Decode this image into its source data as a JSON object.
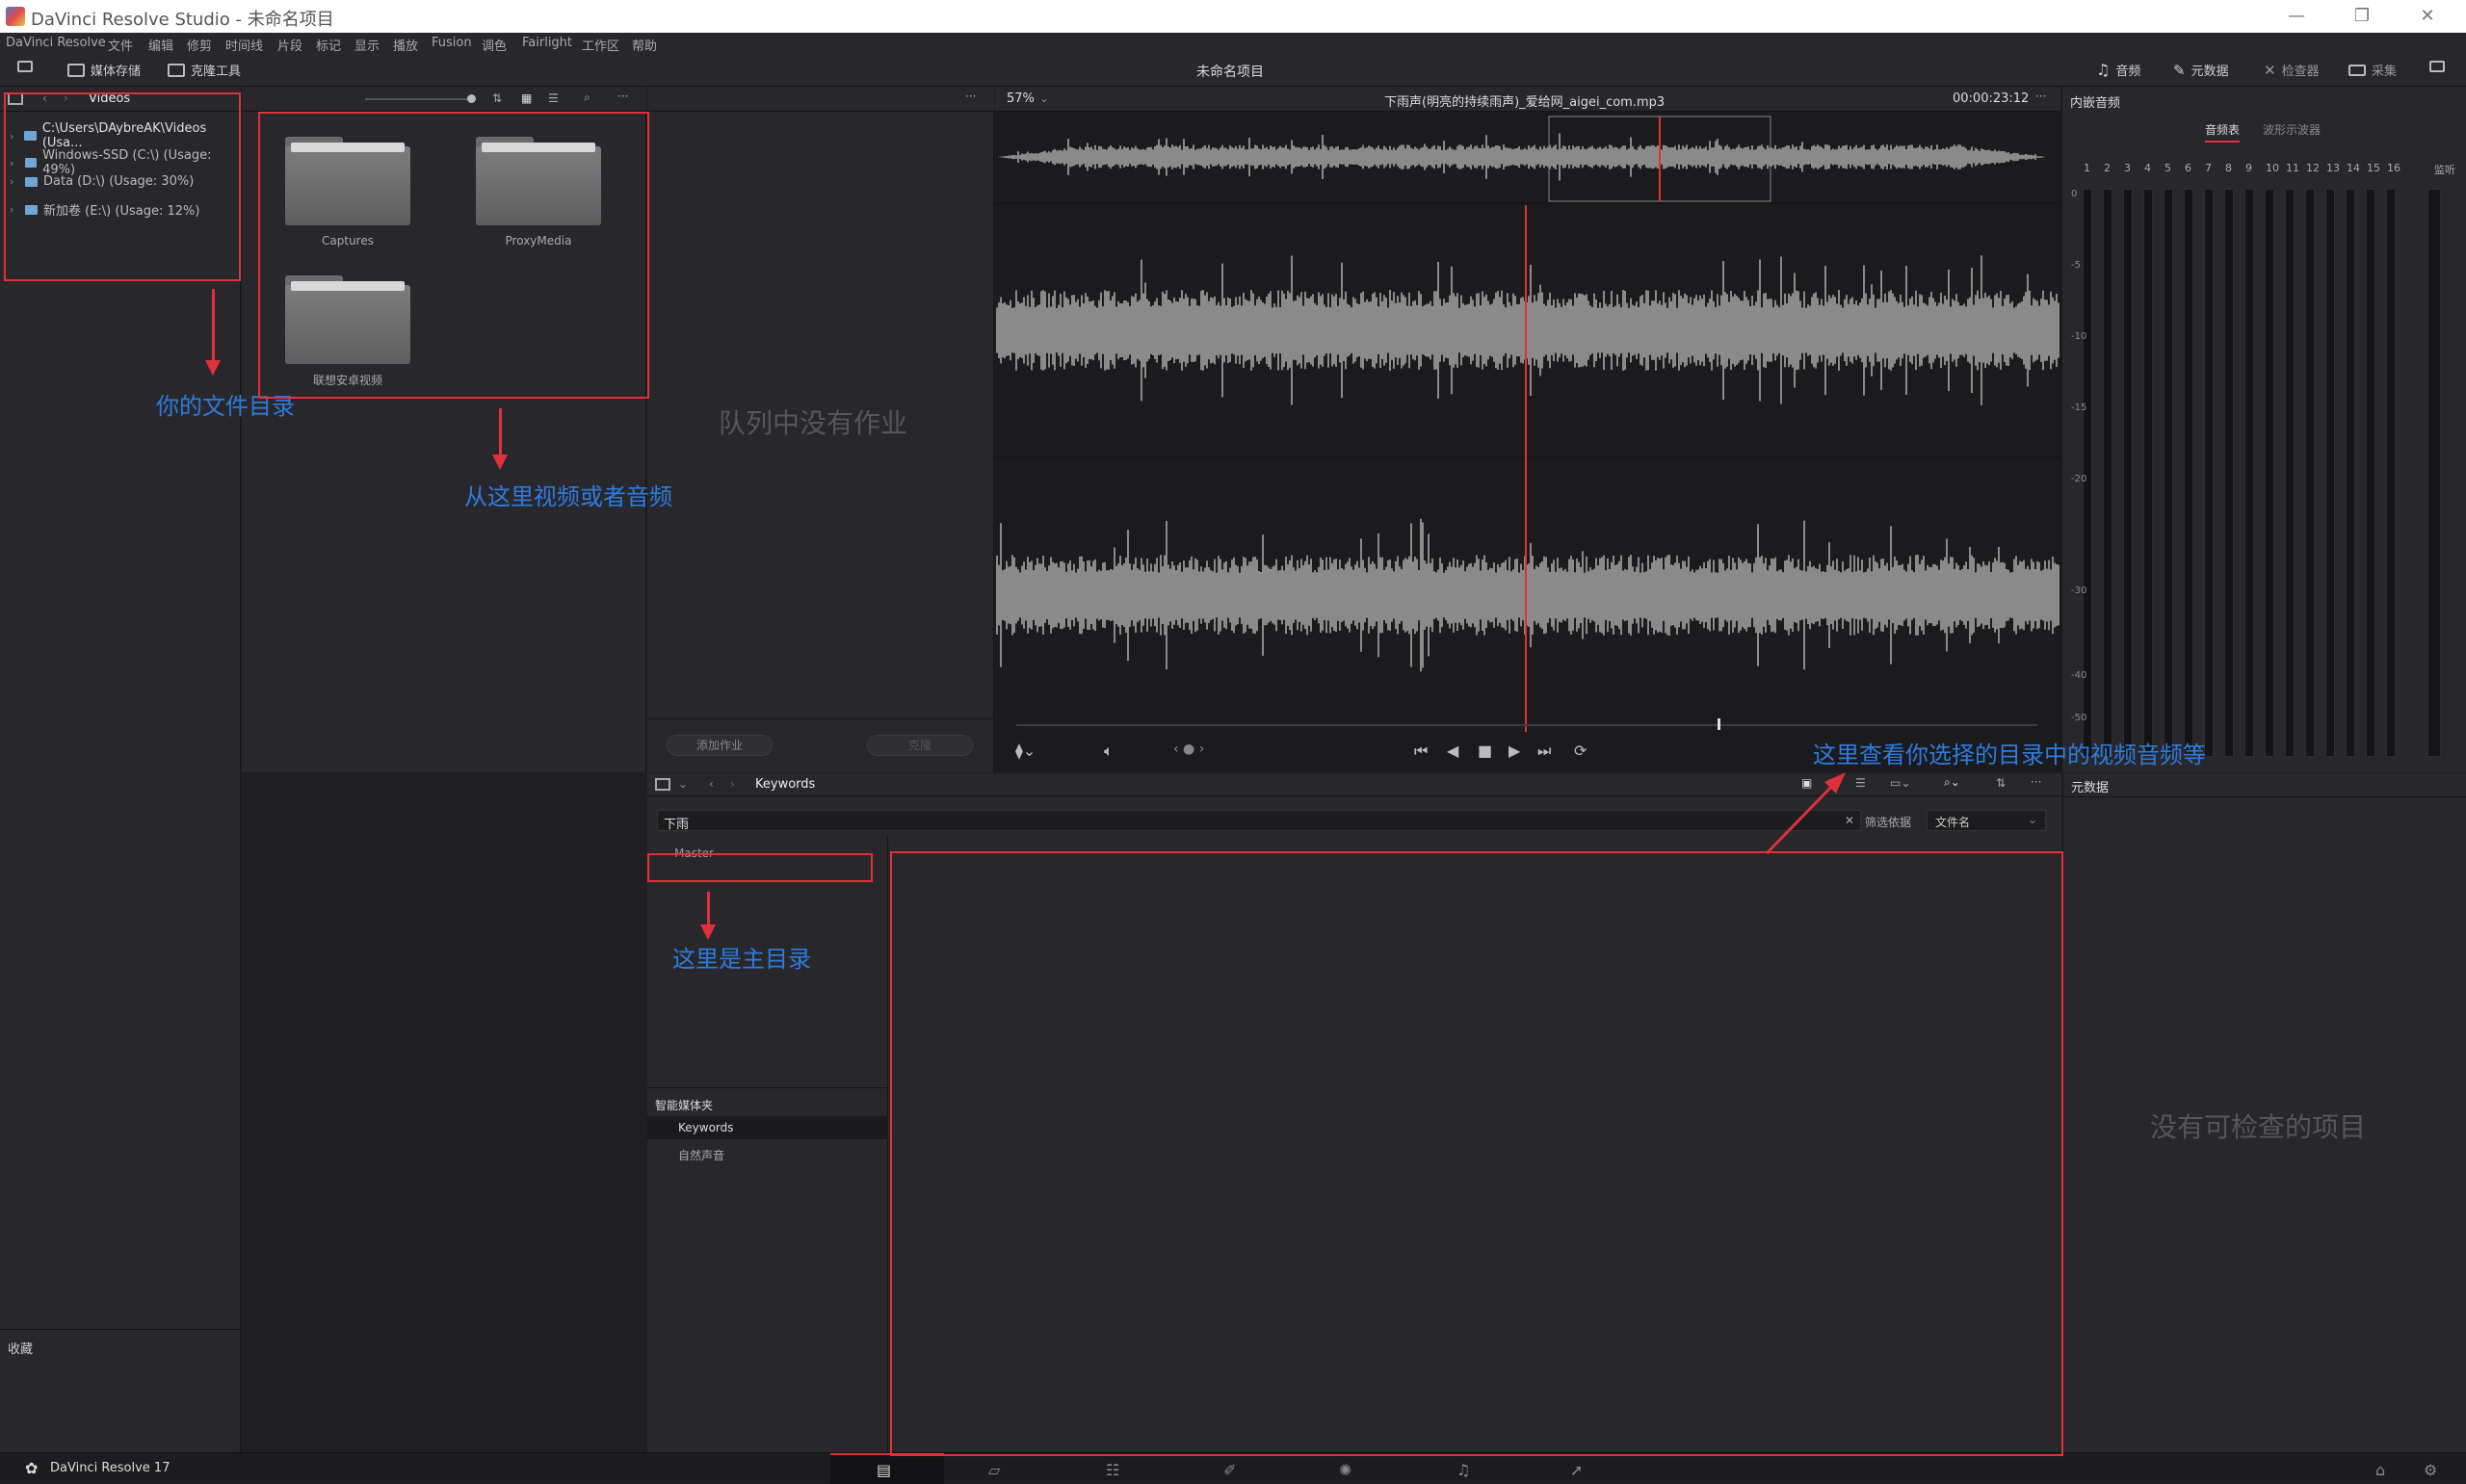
{
  "window": {
    "title": "DaVinci Resolve Studio - 未命名项目",
    "controls": [
      "—",
      "❐",
      "✕"
    ]
  },
  "menu": [
    "DaVinci Resolve",
    "文件",
    "编辑",
    "修剪",
    "时间线",
    "片段",
    "标记",
    "显示",
    "播放",
    "Fusion",
    "调色",
    "Fairlight",
    "工作区",
    "帮助"
  ],
  "toolbar": {
    "media_storage": "媒体存储",
    "clone_tool": "克隆工具",
    "project_title": "未命名项目",
    "audio": "音频",
    "metadata": "元数据",
    "inspector": "检查器",
    "capture": "采集"
  },
  "media_storage": {
    "current_folder": "Videos",
    "tree": [
      "C:\\Users\\DAybreAK\\Videos (Usa...",
      "Windows-SSD (C:\\) (Usage: 49%)",
      "Data (D:\\) (Usage: 30%)",
      "新加卷 (E:\\) (Usage: 12%)"
    ],
    "favorites_label": "收藏",
    "folders": [
      "Captures",
      "ProxyMedia",
      "联想安卓视频"
    ]
  },
  "clone": {
    "empty_text": "队列中没有作业",
    "add_job": "添加作业",
    "clone_button": "克隆"
  },
  "viewer": {
    "zoom": "57%",
    "filename": "下雨声(明亮的持续雨声)_爱给网_aigei_com.mp3",
    "timecode": "00:00:23:12"
  },
  "audio_panel": {
    "title": "内嵌音频",
    "tab_meters": "音频表",
    "tab_waveform": "波形示波器",
    "channels": [
      "1",
      "2",
      "3",
      "4",
      "5",
      "6",
      "7",
      "8",
      "9",
      "10",
      "11",
      "12",
      "13",
      "14",
      "15",
      "16"
    ],
    "monitor": "监听",
    "db_scale": [
      "0",
      "-5",
      "-10",
      "-15",
      "-20",
      "-30",
      "-40",
      "-50"
    ]
  },
  "media_pool": {
    "bin_title": "Keywords",
    "search_value": "下雨",
    "filter_by_label": "筛选依据",
    "filter_by_value": "文件名",
    "master": "Master",
    "smart_bins_label": "智能媒体夹",
    "smart_bins": [
      "Keywords",
      "自然声音"
    ]
  },
  "metadata_panel": {
    "title": "元数据",
    "empty_text": "没有可检查的项目"
  },
  "annotations": {
    "file_dir": "你的文件目录",
    "from_here": "从这里视频或者音频",
    "main_dir": "这里是主目录",
    "view_here": "这里查看你选择的目录中的视频音频等"
  },
  "footer": {
    "app_version": "DaVinci Resolve 17"
  },
  "colors": {
    "accent_red": "#e0303a",
    "annotation_blue": "#2e7be0",
    "waveform": "#8a8a8a"
  }
}
